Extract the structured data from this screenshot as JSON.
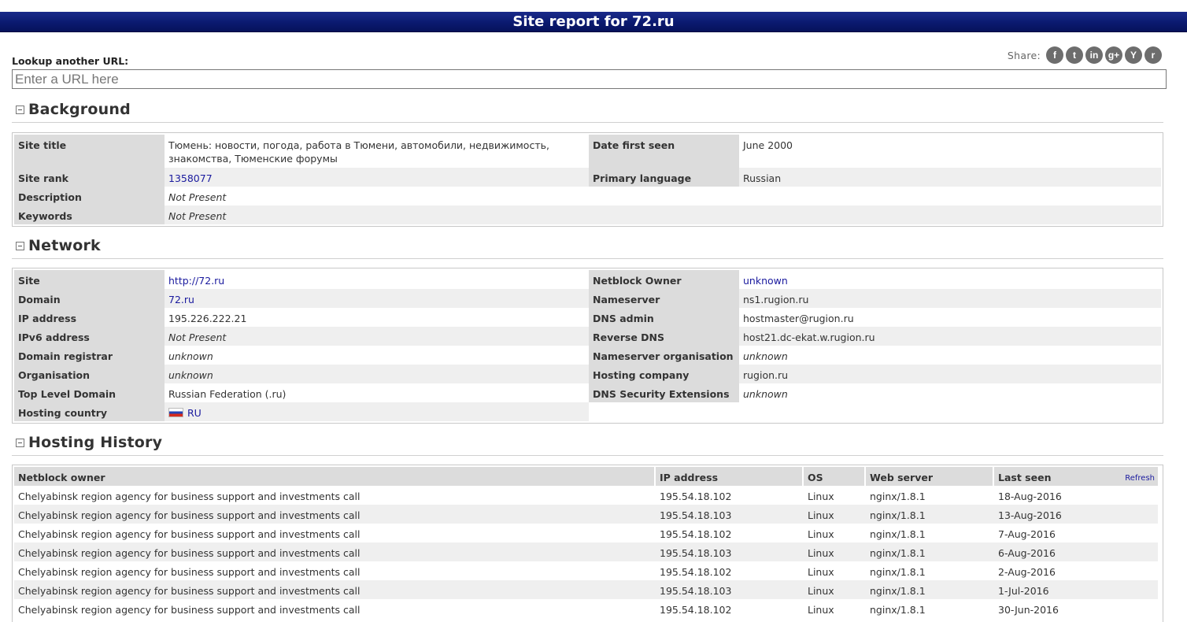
{
  "header": {
    "title": "Site report for 72.ru"
  },
  "lookup": {
    "label": "Lookup another URL:",
    "placeholder": "Enter a URL here"
  },
  "share": {
    "label": "Share:",
    "buttons": [
      {
        "icon": "facebook-icon",
        "glyph": "f"
      },
      {
        "icon": "twitter-icon",
        "glyph": "t"
      },
      {
        "icon": "linkedin-icon",
        "glyph": "in"
      },
      {
        "icon": "google-plus-icon",
        "glyph": "g+"
      },
      {
        "icon": "hacker-news-icon",
        "glyph": "Y"
      },
      {
        "icon": "reddit-icon",
        "glyph": "r"
      }
    ]
  },
  "background": {
    "title": "Background",
    "site_title_label": "Site title",
    "site_title_value": "Тюмень: новости, погода, работа в Тюмени, автомобили, недвижимость, знакомства, Тюменские форумы",
    "date_first_seen_label": "Date first seen",
    "date_first_seen_value": "June 2000",
    "site_rank_label": "Site rank",
    "site_rank_value": "1358077",
    "primary_language_label": "Primary language",
    "primary_language_value": "Russian",
    "description_label": "Description",
    "description_value": "Not Present",
    "keywords_label": "Keywords",
    "keywords_value": "Not Present"
  },
  "network": {
    "title": "Network",
    "site_label": "Site",
    "site_value": "http://72.ru",
    "netblock_owner_label": "Netblock Owner",
    "netblock_owner_value": "unknown",
    "domain_label": "Domain",
    "domain_value": "72.ru",
    "nameserver_label": "Nameserver",
    "nameserver_value": "ns1.rugion.ru",
    "ip_label": "IP address",
    "ip_value": "195.226.222.21",
    "dns_admin_label": "DNS admin",
    "dns_admin_value": "hostmaster@rugion.ru",
    "ipv6_label": "IPv6 address",
    "ipv6_value": "Not Present",
    "reverse_dns_label": "Reverse DNS",
    "reverse_dns_value": "host21.dc-ekat.w.rugion.ru",
    "registrar_label": "Domain registrar",
    "registrar_value": "unknown",
    "ns_org_label": "Nameserver organisation",
    "ns_org_value": "unknown",
    "organisation_label": "Organisation",
    "organisation_value": "unknown",
    "hosting_company_label": "Hosting company",
    "hosting_company_value": "rugion.ru",
    "tld_label": "Top Level Domain",
    "tld_value": "Russian Federation (.ru)",
    "dnssec_label": "DNS Security Extensions",
    "dnssec_value": "unknown",
    "hosting_country_label": "Hosting country",
    "hosting_country_value": "RU"
  },
  "history": {
    "title": "Hosting History",
    "refresh_label": "Refresh",
    "columns": [
      "Netblock owner",
      "IP address",
      "OS",
      "Web server",
      "Last seen"
    ],
    "rows": [
      {
        "owner": "Chelyabinsk region agency for business support and investments call",
        "ip": "195.54.18.102",
        "os": "Linux",
        "server": "nginx/1.8.1",
        "seen": "18-Aug-2016"
      },
      {
        "owner": "Chelyabinsk region agency for business support and investments call",
        "ip": "195.54.18.103",
        "os": "Linux",
        "server": "nginx/1.8.1",
        "seen": "13-Aug-2016"
      },
      {
        "owner": "Chelyabinsk region agency for business support and investments call",
        "ip": "195.54.18.102",
        "os": "Linux",
        "server": "nginx/1.8.1",
        "seen": "7-Aug-2016"
      },
      {
        "owner": "Chelyabinsk region agency for business support and investments call",
        "ip": "195.54.18.103",
        "os": "Linux",
        "server": "nginx/1.8.1",
        "seen": "6-Aug-2016"
      },
      {
        "owner": "Chelyabinsk region agency for business support and investments call",
        "ip": "195.54.18.102",
        "os": "Linux",
        "server": "nginx/1.8.1",
        "seen": "2-Aug-2016"
      },
      {
        "owner": "Chelyabinsk region agency for business support and investments call",
        "ip": "195.54.18.103",
        "os": "Linux",
        "server": "nginx/1.8.1",
        "seen": "1-Jul-2016"
      },
      {
        "owner": "Chelyabinsk region agency for business support and investments call",
        "ip": "195.54.18.102",
        "os": "Linux",
        "server": "nginx/1.8.1",
        "seen": "30-Jun-2016"
      }
    ]
  }
}
